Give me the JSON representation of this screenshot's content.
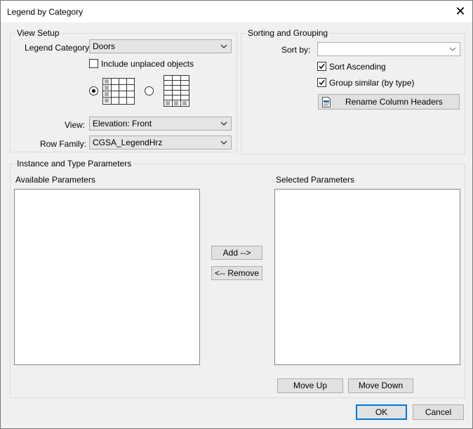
{
  "window": {
    "title": "Legend by Category",
    "close_glyph": "✕"
  },
  "view_setup": {
    "group_label": "View Setup",
    "legend_category_label": "Legend Category:",
    "legend_category_value": "Doors",
    "include_unplaced_label": "Include unplaced objects",
    "include_unplaced_checked": false,
    "layout_horizontal_selected": true,
    "view_label": "View:",
    "view_value": "Elevation: Front",
    "row_family_label": "Row Family:",
    "row_family_value": "CGSA_LegendHrz"
  },
  "sorting": {
    "group_label": "Sorting and Grouping",
    "sort_by_label": "Sort by:",
    "sort_by_value": "",
    "sort_ascending_label": "Sort Ascending",
    "sort_ascending_checked": true,
    "group_similar_label": "Group similar (by type)",
    "group_similar_checked": true,
    "rename_headers_label": "Rename Column Headers"
  },
  "parameters": {
    "group_label": "Instance and Type Parameters",
    "available_label": "Available Parameters",
    "selected_label": "Selected Parameters",
    "available_items": [],
    "selected_items": [],
    "add_label": "Add -->",
    "remove_label": "<-- Remove",
    "move_up_label": "Move Up",
    "move_down_label": "Move Down"
  },
  "footer": {
    "ok_label": "OK",
    "cancel_label": "Cancel"
  },
  "colors": {
    "accent": "#0078d7",
    "background": "#f0f0f0"
  }
}
